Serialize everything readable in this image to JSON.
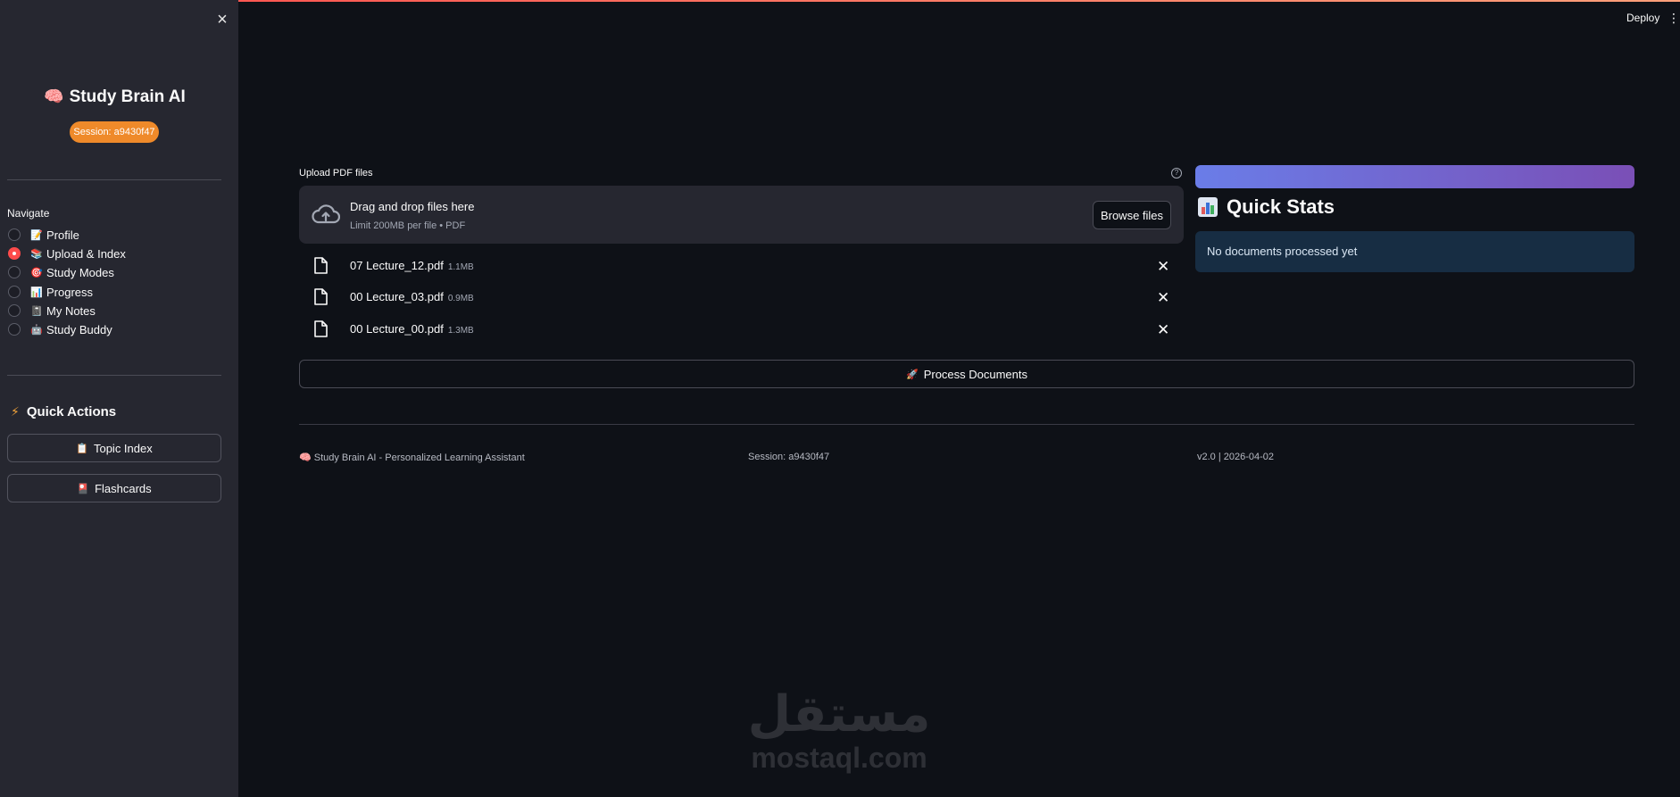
{
  "window": {
    "deploy_label": "Deploy",
    "menu_icon": "kebab-menu-icon"
  },
  "sidebar": {
    "close_icon": "close-icon",
    "brand": {
      "emoji": "🧠",
      "title": "Study Brain AI"
    },
    "session_badge": "Session: a9430f47",
    "nav": {
      "title": "Navigate",
      "items": [
        {
          "emoji": "📝",
          "label": "Profile",
          "selected": false
        },
        {
          "emoji": "📚",
          "label": "Upload & Index",
          "selected": true
        },
        {
          "emoji": "🎯",
          "label": "Study Modes",
          "selected": false
        },
        {
          "emoji": "📊",
          "label": "Progress",
          "selected": false
        },
        {
          "emoji": "📓",
          "label": "My Notes",
          "selected": false
        },
        {
          "emoji": "🤖",
          "label": "Study Buddy",
          "selected": false
        }
      ]
    },
    "quick_actions": {
      "icon": "lightning-icon",
      "title": "Quick Actions",
      "buttons": [
        {
          "emoji": "📋",
          "label": "Topic Index"
        },
        {
          "emoji": "🎴",
          "label": "Flashcards"
        }
      ]
    }
  },
  "main": {
    "upload": {
      "label": "Upload PDF files",
      "help_icon": "help-icon",
      "dropzone": {
        "icon": "cloud-upload-icon",
        "title": "Drag and drop files here",
        "subtitle": "Limit 200MB per file • PDF",
        "browse_label": "Browse files"
      },
      "files": [
        {
          "name": "07 Lecture_12.pdf",
          "size": "1.1MB"
        },
        {
          "name": "00 Lecture_03.pdf",
          "size": "0.9MB"
        },
        {
          "name": "00 Lecture_00.pdf",
          "size": "1.3MB"
        }
      ]
    },
    "process_button": {
      "emoji": "🚀",
      "label": "Process Documents"
    },
    "footer": {
      "left": "🧠 Study Brain AI - Personalized Learning Assistant",
      "center": "Session: a9430f47",
      "right": "v2.0 | 2026-04-02"
    }
  },
  "stats": {
    "title": "Quick Stats",
    "icon": "bar-chart-icon",
    "info": "No documents processed yet"
  },
  "watermark": {
    "arabic": "مستقل",
    "latin": "mostaql.com"
  },
  "colors": {
    "accent": "#ff4b4b",
    "badge": "#ef8a2a",
    "stats_gradient_start": "#6a7de8",
    "stats_gradient_end": "#7a4fb6",
    "info_bg": "#172d43"
  }
}
